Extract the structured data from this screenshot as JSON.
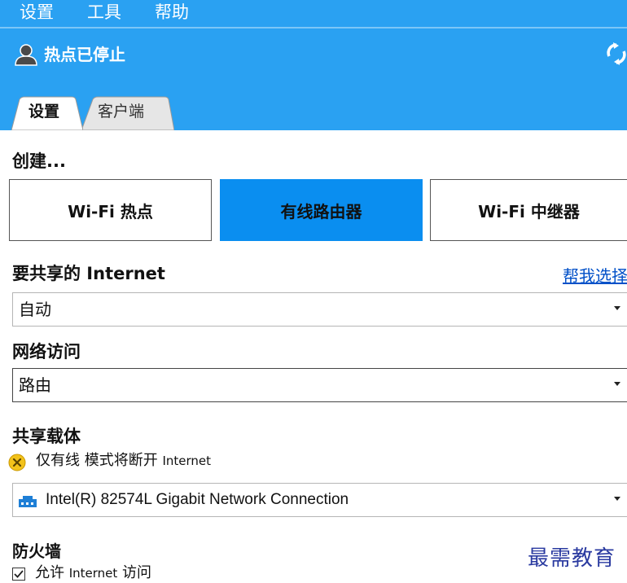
{
  "menu": {
    "settings": "设置",
    "tools": "工具",
    "help": "帮助"
  },
  "status": {
    "text": "热点已停止",
    "icon": "user-icon",
    "refresh_icon": "refresh-icon"
  },
  "tabs": [
    {
      "label": "设置",
      "active": true
    },
    {
      "label": "客户端",
      "active": false
    }
  ],
  "create": {
    "title": "创建...",
    "modes": [
      {
        "label": "Wi-Fi 热点",
        "active": false
      },
      {
        "label": "有线路由器",
        "active": true
      },
      {
        "label": "Wi-Fi 中继器",
        "active": false
      }
    ]
  },
  "internet": {
    "title": "要共享的 Internet",
    "help_link": "帮我选择",
    "value": "自动"
  },
  "network_access": {
    "title": "网络访问",
    "value": "路由"
  },
  "shared_carrier": {
    "title": "共享载体",
    "warning_main": "仅有线 模式将断开 ",
    "warning_tail": "Internet",
    "adapter": "Intel(R) 82574L Gigabit Network Connection"
  },
  "firewall": {
    "title": "防火墙",
    "checkbox_main": "允许 ",
    "checkbox_small": "Internet",
    "checkbox_tail": " 访问",
    "checked": true
  },
  "watermark": "最需教育",
  "colors": {
    "header_blue": "#2aa1f2",
    "active_mode": "#0a8ef0",
    "link": "#0050c8"
  }
}
